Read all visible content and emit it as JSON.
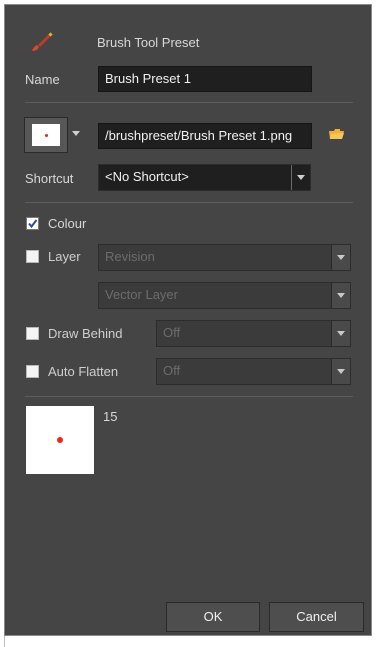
{
  "dialog": {
    "title": "Brush Tool Preset"
  },
  "name_row": {
    "label": "Name",
    "value": "Brush Preset 1"
  },
  "preset_row": {
    "path": "/brushpreset/Brush Preset 1.png"
  },
  "shortcut_row": {
    "label": "Shortcut",
    "value": "<No Shortcut>"
  },
  "options": {
    "colour": {
      "label": "Colour",
      "checked": true
    },
    "layer": {
      "label": "Layer",
      "checked": false,
      "combo1": "Revision",
      "combo2": "Vector Layer"
    },
    "draw_behind": {
      "label": "Draw Behind",
      "checked": false,
      "value": "Off"
    },
    "auto_flatten": {
      "label": "Auto Flatten",
      "checked": false,
      "value": "Off"
    }
  },
  "preview": {
    "size": "15"
  },
  "buttons": {
    "ok": "OK",
    "cancel": "Cancel"
  },
  "colors": {
    "accent_brush": "#c43a2a",
    "dot": "#e8291b",
    "folder": "#f2b035"
  }
}
